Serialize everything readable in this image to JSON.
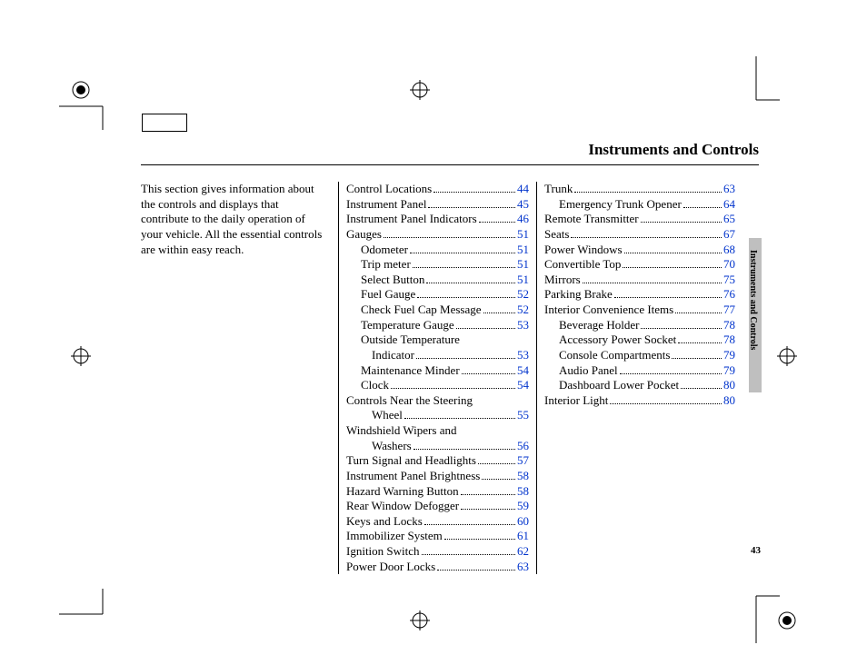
{
  "title": "Instruments and Controls",
  "intro": "This section gives information about the controls and displays that contribute to the daily operation of your vehicle. All the essential controls are within easy reach.",
  "side_label": "Instruments and Controls",
  "page_number": "43",
  "col2": [
    {
      "label": "Control Locations",
      "page": "44",
      "indent": 0
    },
    {
      "label": "Instrument Panel",
      "page": "45",
      "indent": 0
    },
    {
      "label": "Instrument Panel Indicators",
      "page": "46",
      "indent": 0
    },
    {
      "label": "Gauges",
      "page": "51",
      "indent": 0
    },
    {
      "label": "Odometer",
      "page": "51",
      "indent": 1
    },
    {
      "label": "Trip meter",
      "page": "51",
      "indent": 1
    },
    {
      "label": "Select Button",
      "page": "51",
      "indent": 1
    },
    {
      "label": "Fuel Gauge",
      "page": "52",
      "indent": 1
    },
    {
      "label": "Check Fuel Cap Message",
      "page": "52",
      "indent": 1
    },
    {
      "label": "Temperature Gauge",
      "page": "53",
      "indent": 1
    },
    {
      "label": "Outside Temperature",
      "cont": "Indicator",
      "page": "53",
      "indent": 1
    },
    {
      "label": "Maintenance Minder",
      "page": "54",
      "indent": 1
    },
    {
      "label": "Clock",
      "page": "54",
      "indent": 1
    },
    {
      "label": "Controls Near the Steering",
      "cont": "Wheel",
      "page": "55",
      "indent": 0
    },
    {
      "label": "Windshield Wipers and",
      "cont": "Washers",
      "page": "56",
      "indent": 0
    },
    {
      "label": "Turn Signal and Headlights",
      "page": "57",
      "indent": 0
    },
    {
      "label": "Instrument Panel Brightness",
      "page": "58",
      "indent": 0
    },
    {
      "label": "Hazard Warning Button",
      "page": "58",
      "indent": 0
    },
    {
      "label": "Rear Window Defogger",
      "page": "59",
      "indent": 0
    },
    {
      "label": "Keys and Locks",
      "page": "60",
      "indent": 0
    },
    {
      "label": "Immobilizer System",
      "page": "61",
      "indent": 0
    },
    {
      "label": "Ignition Switch",
      "page": "62",
      "indent": 0
    },
    {
      "label": "Power Door Locks",
      "page": "63",
      "indent": 0
    }
  ],
  "col3": [
    {
      "label": "Trunk",
      "page": "63",
      "indent": 0
    },
    {
      "label": "Emergency Trunk Opener",
      "page": "64",
      "indent": 1
    },
    {
      "label": "Remote Transmitter",
      "page": "65",
      "indent": 0
    },
    {
      "label": "Seats",
      "page": "67",
      "indent": 0
    },
    {
      "label": "Power Windows",
      "page": "68",
      "indent": 0
    },
    {
      "label": "Convertible Top",
      "page": "70",
      "indent": 0
    },
    {
      "label": "Mirrors",
      "page": "75",
      "indent": 0
    },
    {
      "label": "Parking Brake",
      "page": "76",
      "indent": 0
    },
    {
      "label": "Interior Convenience Items",
      "page": "77",
      "indent": 0
    },
    {
      "label": "Beverage Holder",
      "page": "78",
      "indent": 1
    },
    {
      "label": "Accessory Power Socket",
      "page": "78",
      "indent": 1
    },
    {
      "label": "Console Compartments",
      "page": "79",
      "indent": 1
    },
    {
      "label": "Audio Panel",
      "page": "79",
      "indent": 1
    },
    {
      "label": "Dashboard Lower Pocket",
      "page": "80",
      "indent": 1
    },
    {
      "label": "Interior Light",
      "page": "80",
      "indent": 0
    }
  ]
}
